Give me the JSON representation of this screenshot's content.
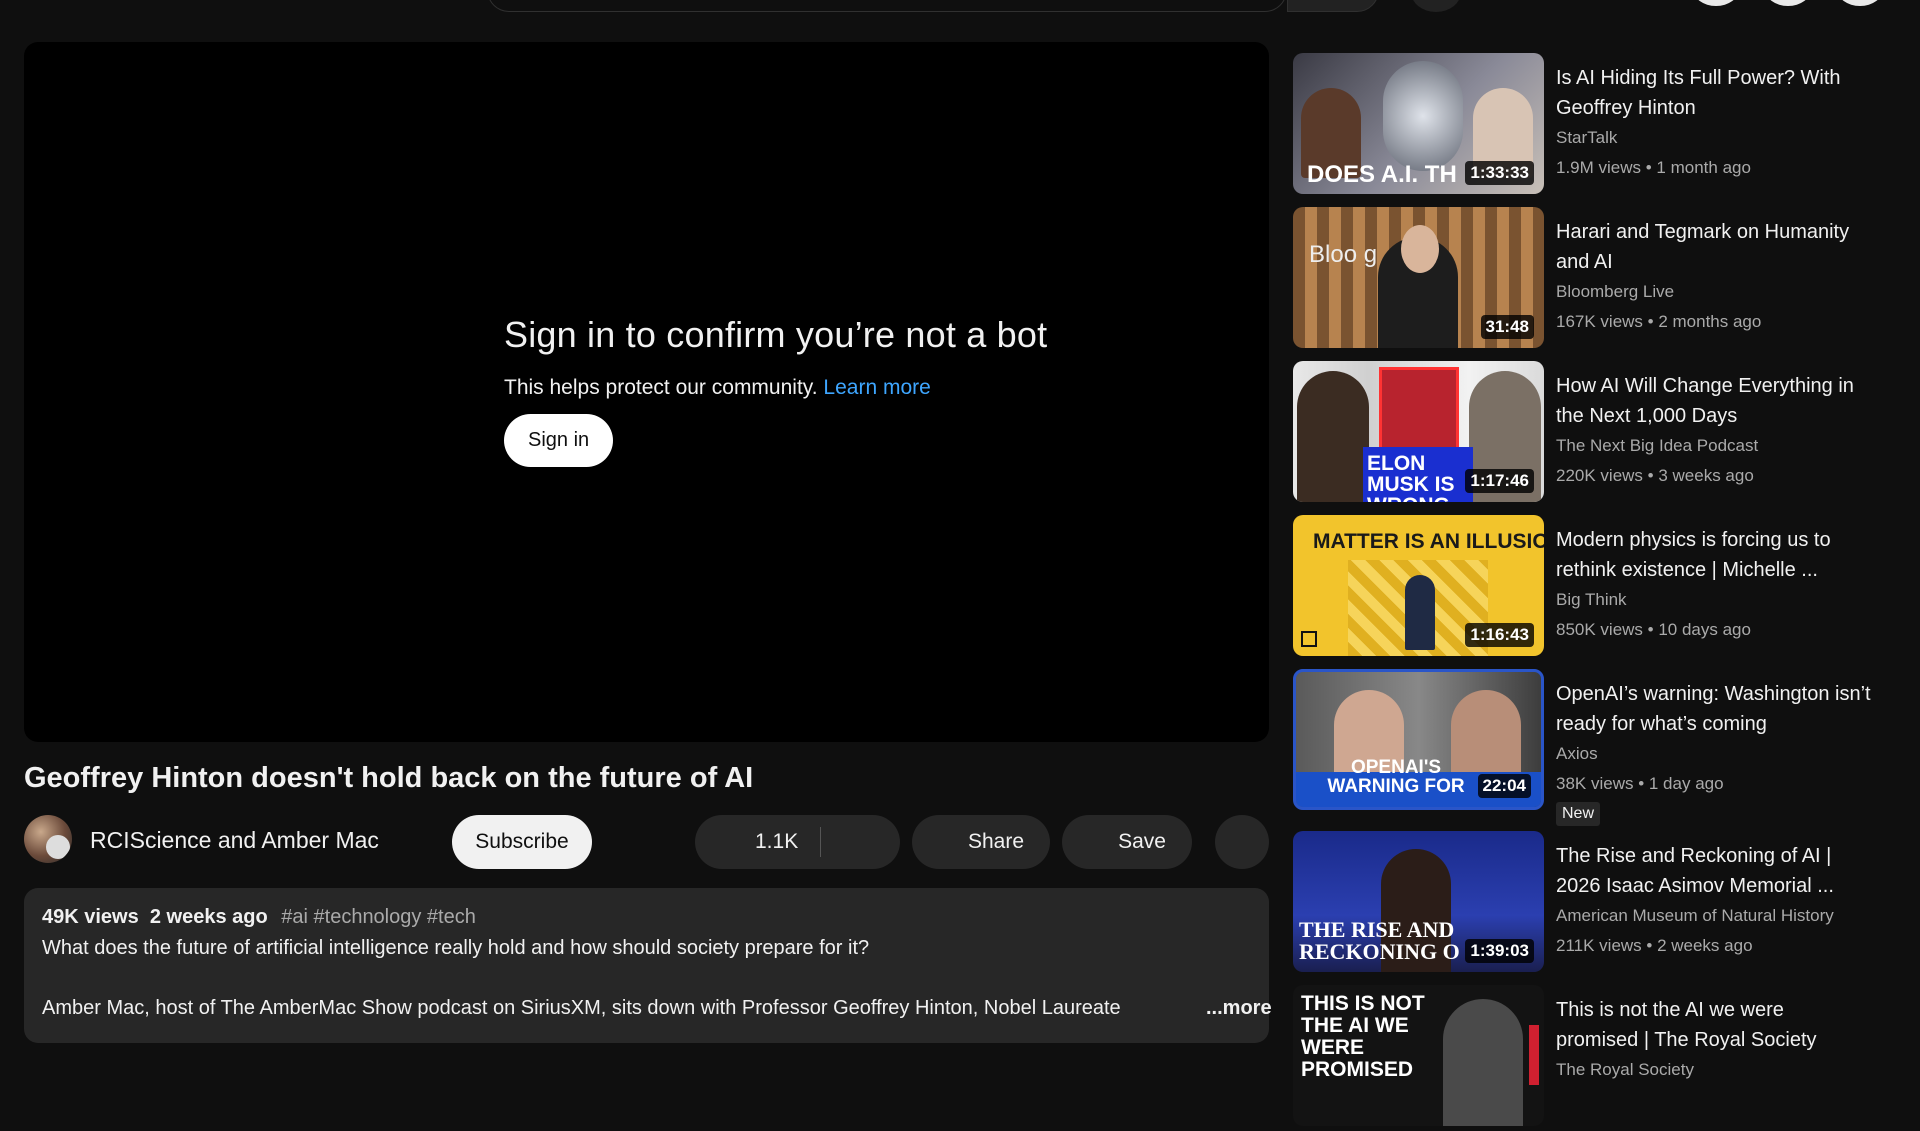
{
  "player": {
    "signin_title": "Sign in to confirm you’re not a bot",
    "signin_sub": "This helps protect our community.",
    "learn_more": "Learn more",
    "signin_button": "Sign in"
  },
  "video": {
    "title": "Geoffrey Hinton doesn't hold back on the future of AI",
    "channel": "RCIScience and Amber Mac",
    "subscribe": "Subscribe",
    "likes": "1.1K",
    "share": "Share",
    "save": "Save"
  },
  "description": {
    "views": "49K views",
    "date": "2 weeks ago",
    "tags": "#ai #technology #tech",
    "line1": "What does the future of artificial intelligence really hold and how should society prepare for it?",
    "line2": "Amber Mac, host of The AmberMac Show podcast on SiriusXM, sits down with Professor Geoffrey Hinton, Nobel Laureate",
    "more": "...more"
  },
  "related": [
    {
      "title": "Is AI Hiding Its Full Power? With Geoffrey Hinton",
      "channel": "StarTalk",
      "meta": "1.9M views • 1 month ago",
      "duration": "1:33:33",
      "thumb_text": "DOES A.I. TH"
    },
    {
      "title": "Harari and Tegmark on Humanity and AI",
      "channel": "Bloomberg Live",
      "meta": "167K views • 2 months ago",
      "duration": "31:48",
      "thumb_text": "Bloo     g"
    },
    {
      "title": "How AI Will Change Everything in the Next 1,000 Days",
      "channel": "The Next Big Idea Podcast",
      "meta": "220K views • 3 weeks ago",
      "duration": "1:17:46",
      "thumb_text": "ELON MUSK IS WRONG"
    },
    {
      "title": "Modern physics is forcing us to rethink existence | Michelle ...",
      "channel": "Big Think",
      "meta": "850K views • 10 days ago",
      "duration": "1:16:43",
      "thumb_text": "MATTER IS AN ILLUSION"
    },
    {
      "title": "OpenAI’s warning: Washington isn’t ready for what’s coming",
      "channel": "Axios",
      "meta": "38K views • 1 day ago",
      "duration": "22:04",
      "thumb_text": "OPENAI'S WARNING FOR",
      "badge": "New"
    },
    {
      "title": "The Rise and Reckoning of AI | 2026 Isaac Asimov Memorial ...",
      "channel": "American Museum of Natural History",
      "meta": "211K views • 2 weeks ago",
      "duration": "1:39:03",
      "thumb_text": "THE RISE AND RECKONING O"
    },
    {
      "title": "This is not the AI we were promised | The Royal Society",
      "channel": "The Royal Society",
      "meta": "",
      "duration": "",
      "thumb_text": "THIS IS NOT THE AI WE WERE PROMISED"
    }
  ]
}
